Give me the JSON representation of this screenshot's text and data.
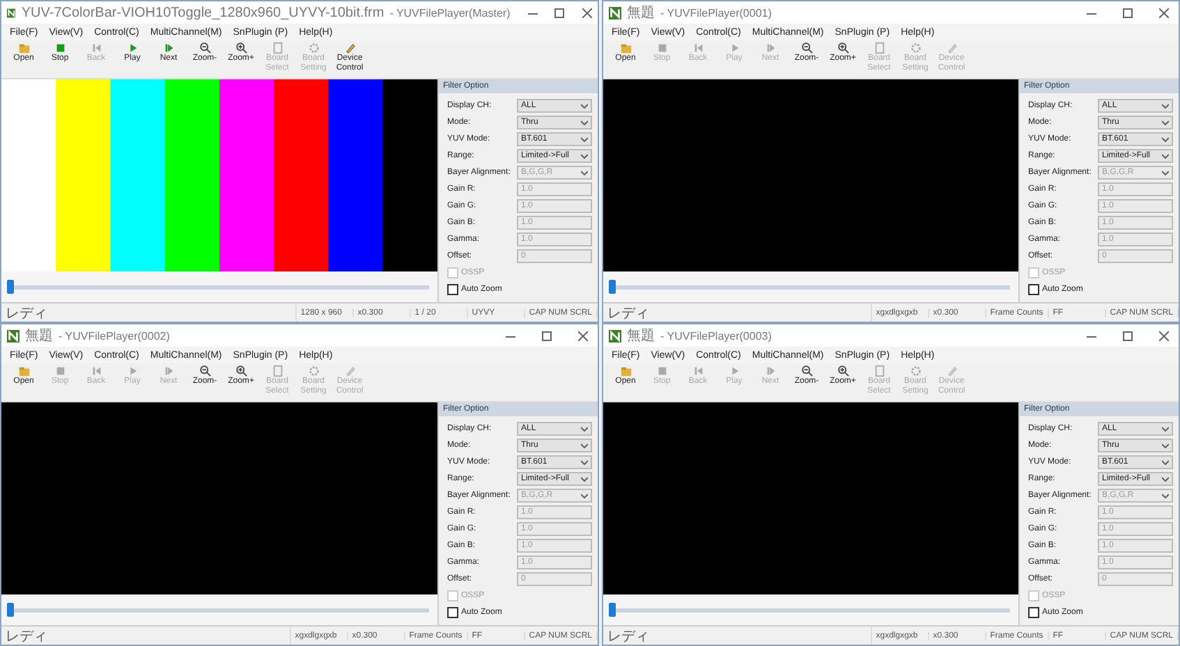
{
  "windows": [
    {
      "title": {
        "document": "YUV-7ColorBar-VIOH10Toggle_1280x960_UYVY-10bit.frm",
        "app": "- YUVFilePlayer(Master)"
      },
      "menu": [
        "File(F)",
        "View(V)",
        "Control(C)",
        "MultiChannel(M)",
        "SnPlugin (P)",
        "Help(H)"
      ],
      "toolbar": [
        {
          "label": "Open",
          "disabled": false
        },
        {
          "label": "Stop",
          "disabled": false
        },
        {
          "label": "Back",
          "disabled": true
        },
        {
          "label": "Play",
          "disabled": false
        },
        {
          "label": "Next",
          "disabled": false
        },
        {
          "label": "Zoom-",
          "disabled": false
        },
        {
          "label": "Zoom+",
          "disabled": false
        },
        {
          "label": "Board Select",
          "disabled": true
        },
        {
          "label": "Board Setting",
          "disabled": true
        },
        {
          "label": "Device Control",
          "disabled": false
        }
      ],
      "video": {
        "kind": "colorbar"
      },
      "slider": {
        "level": 0
      },
      "filter": {
        "title": "Filter Option",
        "fields": [
          {
            "label": "Display CH:",
            "value": "ALL",
            "kind": "select",
            "disabled": false
          },
          {
            "label": "Mode:",
            "value": "Thru",
            "kind": "select",
            "disabled": false
          },
          {
            "label": "YUV Mode:",
            "value": "BT.601",
            "kind": "select",
            "disabled": false
          },
          {
            "label": "Range:",
            "value": "Limited->Full",
            "kind": "select",
            "disabled": false
          },
          {
            "label": "Bayer Alignment:",
            "value": "B,G,G,R",
            "kind": "select",
            "disabled": true
          },
          {
            "label": "Gain R:",
            "value": "1.0",
            "kind": "text",
            "disabled": true
          },
          {
            "label": "Gain G:",
            "value": "1.0",
            "kind": "text",
            "disabled": true
          },
          {
            "label": "Gain B:",
            "value": "1.0",
            "kind": "text",
            "disabled": true
          },
          {
            "label": "Gamma:",
            "value": "1.0",
            "kind": "text",
            "disabled": true
          },
          {
            "label": "Offset:",
            "value": "0",
            "kind": "text",
            "disabled": true
          }
        ],
        "checks": [
          {
            "label": "OSSP",
            "checked": false,
            "disabled": true
          },
          {
            "label": "Auto Zoom",
            "checked": false,
            "disabled": false
          }
        ]
      },
      "status": [
        "レディ",
        "1280 x 960",
        "x0.300",
        "1 / 20",
        "UYVY",
        "CAP NUM SCRL"
      ]
    },
    {
      "title": {
        "document": "無題",
        "app": "- YUVFilePlayer(0001)"
      },
      "menu": [
        "File(F)",
        "View(V)",
        "Control(C)",
        "MultiChannel(M)",
        "SnPlugin (P)",
        "Help(H)"
      ],
      "toolbar": [
        {
          "label": "Open",
          "disabled": false
        },
        {
          "label": "Stop",
          "disabled": true
        },
        {
          "label": "Back",
          "disabled": true
        },
        {
          "label": "Play",
          "disabled": true
        },
        {
          "label": "Next",
          "disabled": true
        },
        {
          "label": "Zoom-",
          "disabled": false
        },
        {
          "label": "Zoom+",
          "disabled": false
        },
        {
          "label": "Board Select",
          "disabled": true
        },
        {
          "label": "Board Setting",
          "disabled": true
        },
        {
          "label": "Device Control",
          "disabled": true
        }
      ],
      "video": {
        "kind": "blank"
      },
      "slider": {
        "level": 0
      },
      "filter": {
        "title": "Filter Option",
        "fields": [
          {
            "label": "Display CH:",
            "value": "ALL",
            "kind": "select",
            "disabled": false
          },
          {
            "label": "Mode:",
            "value": "Thru",
            "kind": "select",
            "disabled": false
          },
          {
            "label": "YUV Mode:",
            "value": "BT.601",
            "kind": "select",
            "disabled": false
          },
          {
            "label": "Range:",
            "value": "Limited->Full",
            "kind": "select",
            "disabled": false
          },
          {
            "label": "Bayer Alignment:",
            "value": "B,G,G,R",
            "kind": "select",
            "disabled": true
          },
          {
            "label": "Gain R:",
            "value": "1.0",
            "kind": "text",
            "disabled": true
          },
          {
            "label": "Gain G:",
            "value": "1.0",
            "kind": "text",
            "disabled": true
          },
          {
            "label": "Gain B:",
            "value": "1.0",
            "kind": "text",
            "disabled": true
          },
          {
            "label": "Gamma:",
            "value": "1.0",
            "kind": "text",
            "disabled": true
          },
          {
            "label": "Offset:",
            "value": "0",
            "kind": "text",
            "disabled": true
          }
        ],
        "checks": [
          {
            "label": "OSSP",
            "checked": false,
            "disabled": true
          },
          {
            "label": "Auto Zoom",
            "checked": false,
            "disabled": false
          }
        ]
      },
      "status": [
        "レディ",
        "xgxdlgxgxb",
        "x0.300",
        "Frame Counts",
        "FF",
        "CAP NUM SCRL"
      ]
    },
    {
      "title": {
        "document": "無題",
        "app": "- YUVFilePlayer(0002)"
      },
      "menu": [
        "File(F)",
        "View(V)",
        "Control(C)",
        "MultiChannel(M)",
        "SnPlugin (P)",
        "Help(H)"
      ],
      "toolbar": [
        {
          "label": "Open",
          "disabled": false
        },
        {
          "label": "Stop",
          "disabled": true
        },
        {
          "label": "Back",
          "disabled": true
        },
        {
          "label": "Play",
          "disabled": true
        },
        {
          "label": "Next",
          "disabled": true
        },
        {
          "label": "Zoom-",
          "disabled": false
        },
        {
          "label": "Zoom+",
          "disabled": false
        },
        {
          "label": "Board Select",
          "disabled": true
        },
        {
          "label": "Board Setting",
          "disabled": true
        },
        {
          "label": "Device Control",
          "disabled": true
        }
      ],
      "video": {
        "kind": "blank"
      },
      "slider": {
        "level": 0
      },
      "filter": {
        "title": "Filter Option",
        "fields": [
          {
            "label": "Display CH:",
            "value": "ALL",
            "kind": "select",
            "disabled": false
          },
          {
            "label": "Mode:",
            "value": "Thru",
            "kind": "select",
            "disabled": false
          },
          {
            "label": "YUV Mode:",
            "value": "BT.601",
            "kind": "select",
            "disabled": false
          },
          {
            "label": "Range:",
            "value": "Limited->Full",
            "kind": "select",
            "disabled": false
          },
          {
            "label": "Bayer Alignment:",
            "value": "B,G,G,R",
            "kind": "select",
            "disabled": true
          },
          {
            "label": "Gain R:",
            "value": "1.0",
            "kind": "text",
            "disabled": true
          },
          {
            "label": "Gain G:",
            "value": "1.0",
            "kind": "text",
            "disabled": true
          },
          {
            "label": "Gain B:",
            "value": "1.0",
            "kind": "text",
            "disabled": true
          },
          {
            "label": "Gamma:",
            "value": "1.0",
            "kind": "text",
            "disabled": true
          },
          {
            "label": "Offset:",
            "value": "0",
            "kind": "text",
            "disabled": true
          }
        ],
        "checks": [
          {
            "label": "OSSP",
            "checked": false,
            "disabled": true
          },
          {
            "label": "Auto Zoom",
            "checked": false,
            "disabled": false
          }
        ]
      },
      "status": [
        "レディ",
        "xgxdlgxgxb",
        "x0.300",
        "Frame Counts",
        "FF",
        "CAP NUM SCRL"
      ]
    },
    {
      "title": {
        "document": "無題",
        "app": "- YUVFilePlayer(0003)"
      },
      "menu": [
        "File(F)",
        "View(V)",
        "Control(C)",
        "MultiChannel(M)",
        "SnPlugin (P)",
        "Help(H)"
      ],
      "toolbar": [
        {
          "label": "Open",
          "disabled": false
        },
        {
          "label": "Stop",
          "disabled": true
        },
        {
          "label": "Back",
          "disabled": true
        },
        {
          "label": "Play",
          "disabled": true
        },
        {
          "label": "Next",
          "disabled": true
        },
        {
          "label": "Zoom-",
          "disabled": false
        },
        {
          "label": "Zoom+",
          "disabled": false
        },
        {
          "label": "Board Select",
          "disabled": true
        },
        {
          "label": "Board Setting",
          "disabled": true
        },
        {
          "label": "Device Control",
          "disabled": true
        }
      ],
      "video": {
        "kind": "blank"
      },
      "slider": {
        "level": 0
      },
      "filter": {
        "title": "Filter Option",
        "fields": [
          {
            "label": "Display CH:",
            "value": "ALL",
            "kind": "select",
            "disabled": false
          },
          {
            "label": "Mode:",
            "value": "Thru",
            "kind": "select",
            "disabled": false
          },
          {
            "label": "YUV Mode:",
            "value": "BT.601",
            "kind": "select",
            "disabled": false
          },
          {
            "label": "Range:",
            "value": "Limited->Full",
            "kind": "select",
            "disabled": false
          },
          {
            "label": "Bayer Alignment:",
            "value": "B,G,G,R",
            "kind": "select",
            "disabled": true
          },
          {
            "label": "Gain R:",
            "value": "1.0",
            "kind": "text",
            "disabled": true
          },
          {
            "label": "Gain G:",
            "value": "1.0",
            "kind": "text",
            "disabled": true
          },
          {
            "label": "Gain B:",
            "value": "1.0",
            "kind": "text",
            "disabled": true
          },
          {
            "label": "Gamma:",
            "value": "1.0",
            "kind": "text",
            "disabled": true
          },
          {
            "label": "Offset:",
            "value": "0",
            "kind": "text",
            "disabled": true
          }
        ],
        "checks": [
          {
            "label": "OSSP",
            "checked": false,
            "disabled": true
          },
          {
            "label": "Auto Zoom",
            "checked": false,
            "disabled": false
          }
        ]
      },
      "status": [
        "レディ",
        "xgxdlgxgxb",
        "x0.300",
        "Frame Counts",
        "FF",
        "CAP NUM SCRL"
      ]
    }
  ]
}
